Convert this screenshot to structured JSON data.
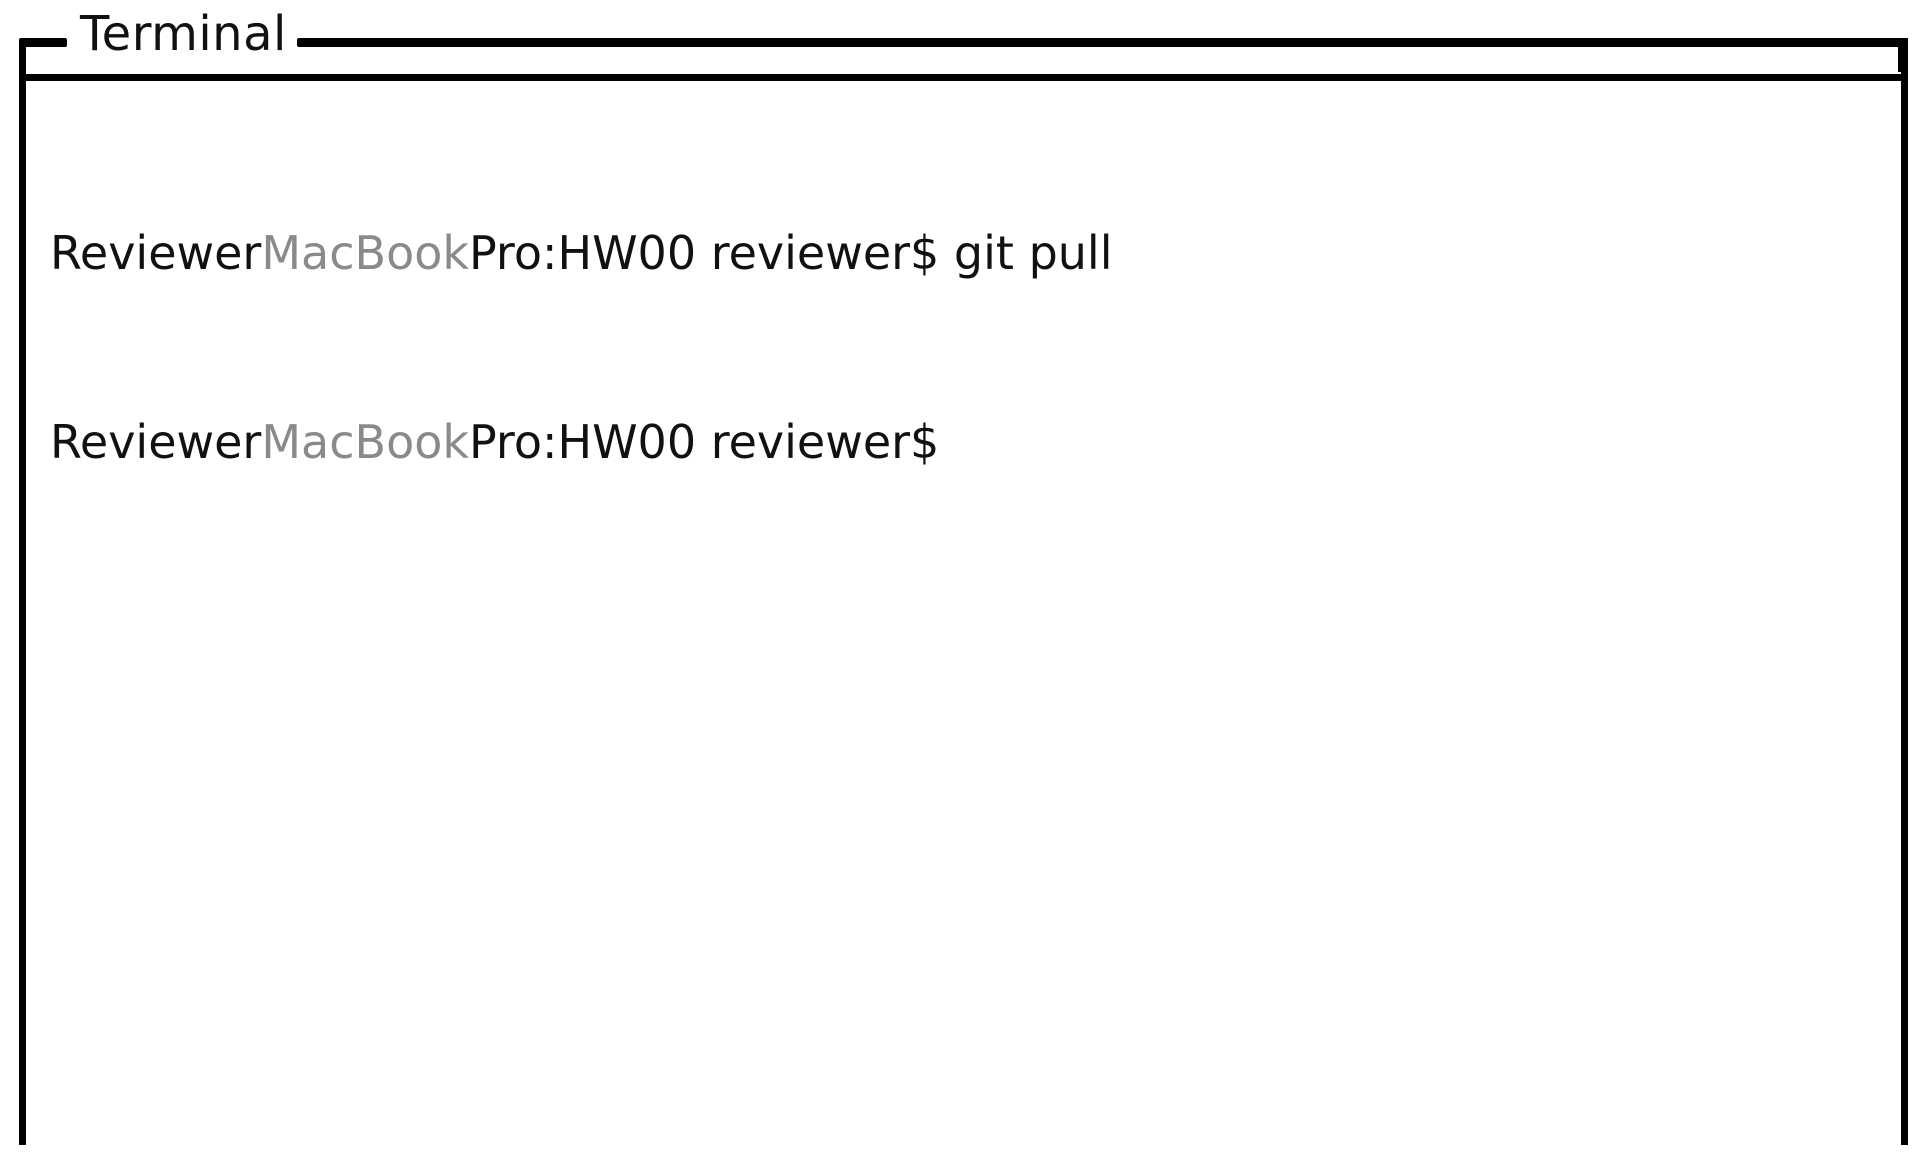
{
  "window": {
    "title": "Terminal"
  },
  "terminal": {
    "lines": [
      {
        "user": "Reviewer",
        "host": "MacBook",
        "suffix": "Pro:HW00 reviewer$",
        "command": " git pull"
      },
      {
        "user": "Reviewer",
        "host": "MacBook",
        "suffix": "Pro:HW00 reviewer$",
        "command": ""
      }
    ]
  },
  "colors": {
    "text": "#111111",
    "host_text": "#8a8a8a",
    "border": "#000000",
    "background": "#ffffff"
  }
}
